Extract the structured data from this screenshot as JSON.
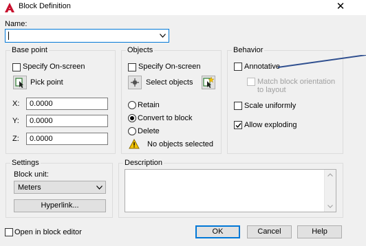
{
  "window": {
    "title": "Block Definition",
    "close_symbol": "✕"
  },
  "name": {
    "label": "Name:",
    "value": ""
  },
  "base_point": {
    "title": "Base point",
    "specify_on_screen": {
      "label": "Specify On-screen",
      "checked": false
    },
    "pick_point_label": "Pick point",
    "x": {
      "label": "X:",
      "value": "0.0000"
    },
    "y": {
      "label": "Y:",
      "value": "0.0000"
    },
    "z": {
      "label": "Z:",
      "value": "0.0000"
    }
  },
  "objects": {
    "title": "Objects",
    "specify_on_screen": {
      "label": "Specify On-screen",
      "checked": false
    },
    "select_objects_label": "Select objects",
    "retain_label": "Retain",
    "convert_label": "Convert to block",
    "delete_label": "Delete",
    "selected_option": "Convert to block",
    "warning_text": "No objects selected"
  },
  "behavior": {
    "title": "Behavior",
    "annotative": {
      "label": "Annotative",
      "checked": false
    },
    "match_orientation": {
      "label_line1": "Match block orientation",
      "label_line2": "to layout",
      "checked": false,
      "enabled": false
    },
    "scale_uniformly": {
      "label": "Scale uniformly",
      "checked": false
    },
    "allow_exploding": {
      "label": "Allow exploding",
      "checked": true
    }
  },
  "settings": {
    "title": "Settings",
    "block_unit_label": "Block unit:",
    "block_unit_value": "Meters",
    "hyperlink_label": "Hyperlink..."
  },
  "description": {
    "title": "Description",
    "value": ""
  },
  "footer": {
    "open_in_editor": {
      "label": "Open in block editor",
      "checked": false
    },
    "ok_label": "OK",
    "cancel_label": "Cancel",
    "help_label": "Help"
  },
  "colors": {
    "accent": "#0078d7",
    "annotation_line": "#2f4f8f",
    "warning": "#f5c400"
  }
}
